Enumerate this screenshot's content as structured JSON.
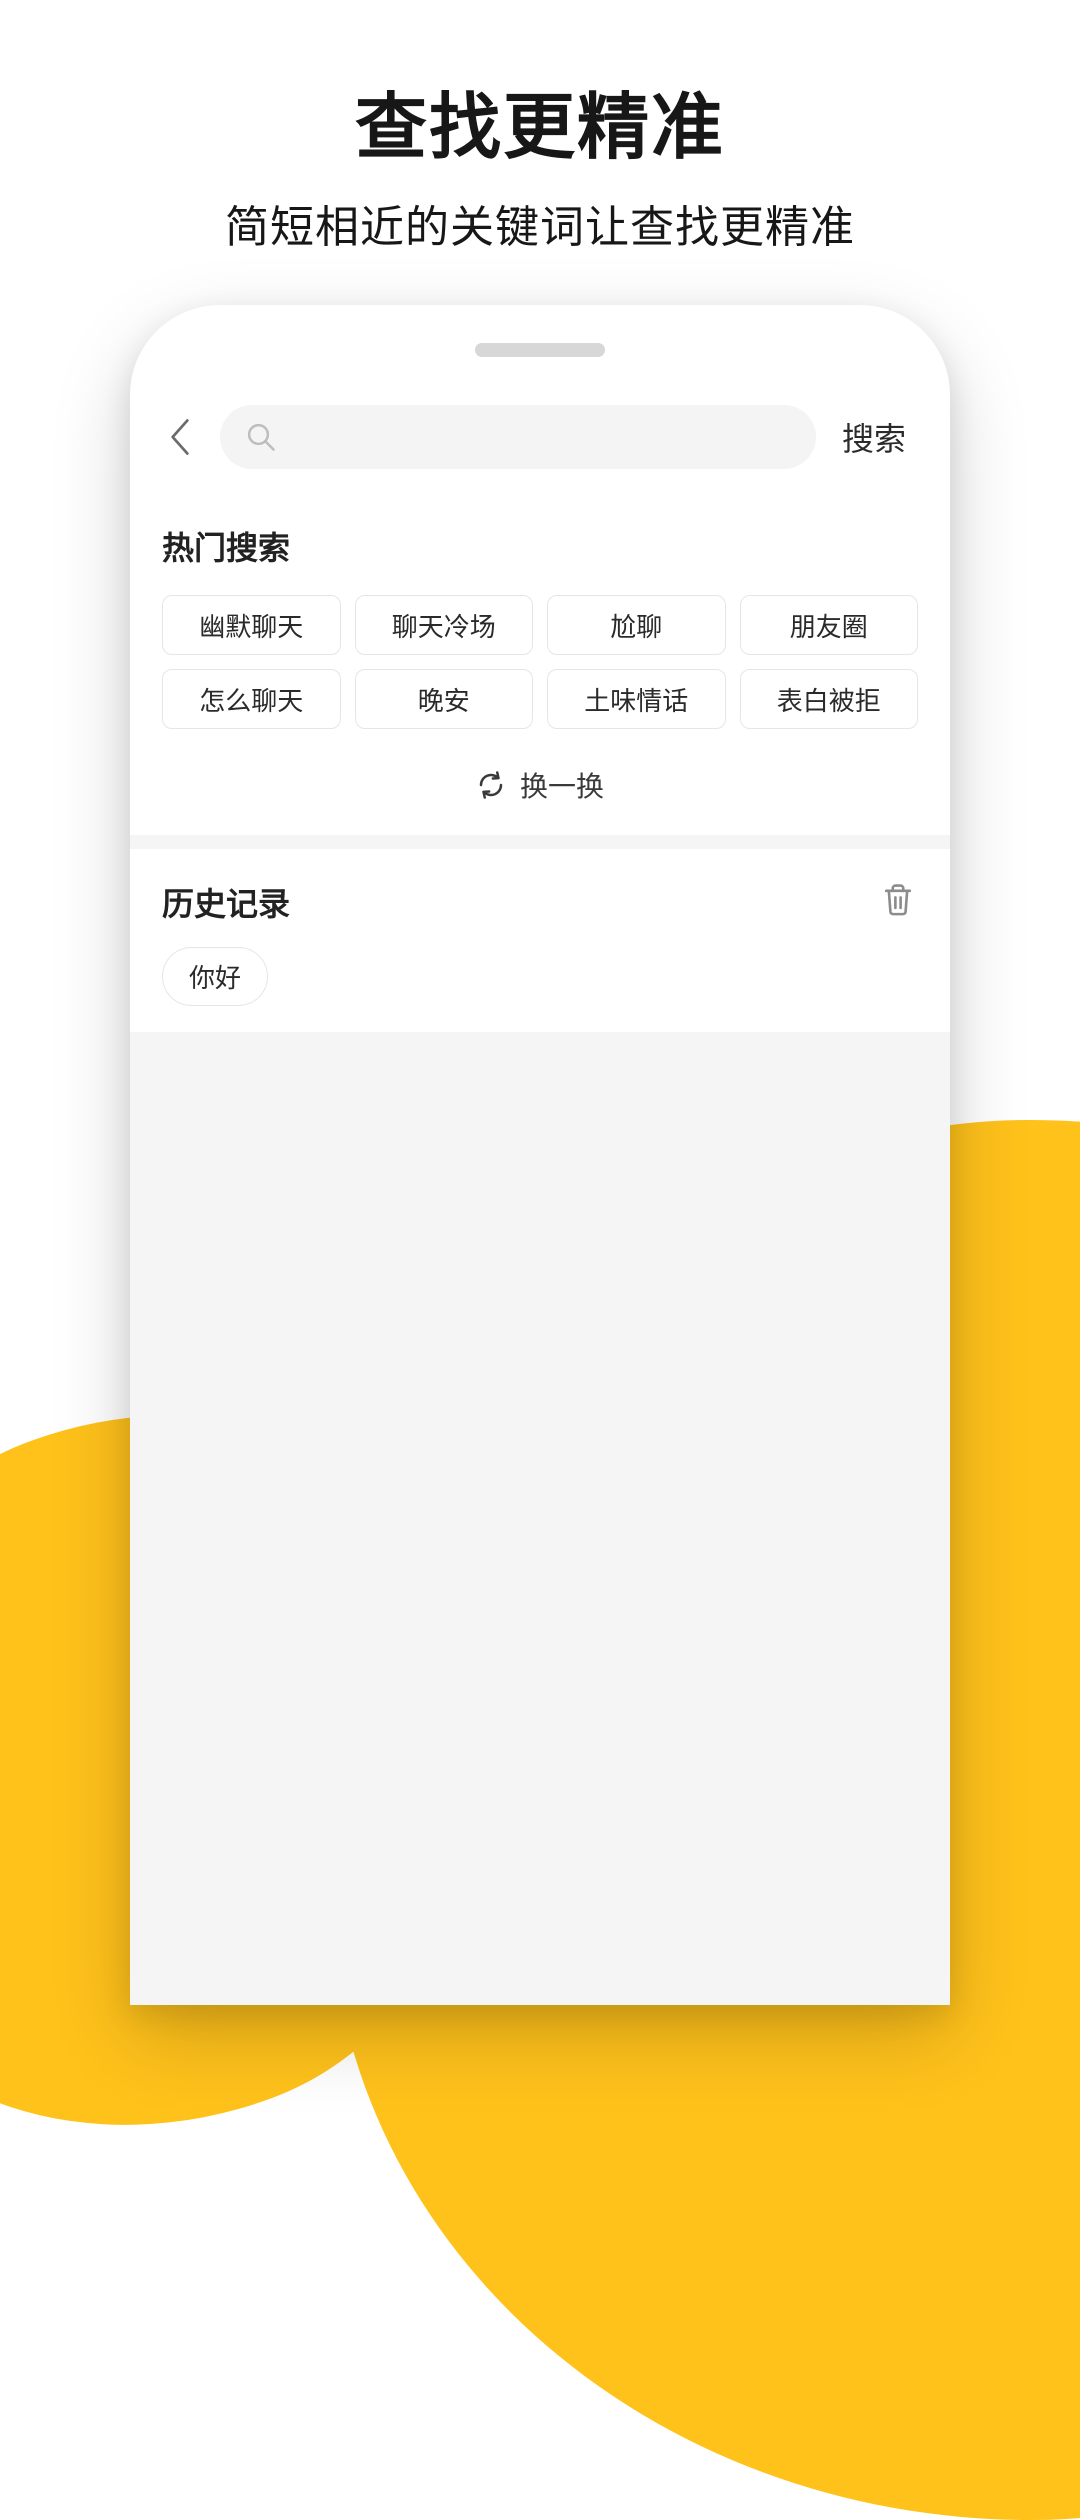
{
  "hero": {
    "title": "查找更精准",
    "subtitle": "简短相近的关键词让查找更精准"
  },
  "search": {
    "button_label": "搜索"
  },
  "hot": {
    "title": "热门搜索",
    "tags": [
      "幽默聊天",
      "聊天冷场",
      "尬聊",
      "朋友圈",
      "怎么聊天",
      "晚安",
      "土味情话",
      "表白被拒"
    ],
    "refresh_label": "换一换"
  },
  "history": {
    "title": "历史记录",
    "items": [
      "你好"
    ]
  }
}
